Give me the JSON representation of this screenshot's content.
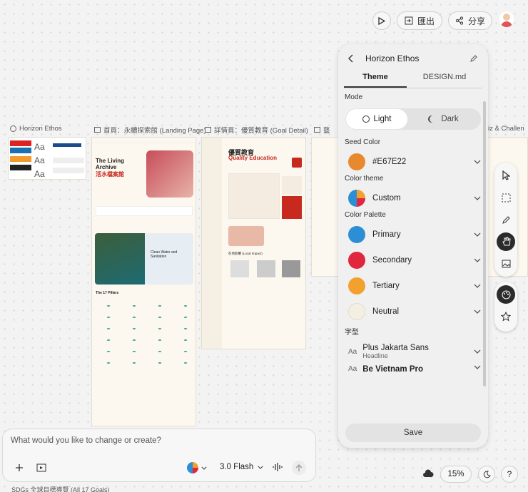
{
  "top": {
    "export": "匯出",
    "share": "分享"
  },
  "frames": {
    "design_system": "Horizon Ethos",
    "landing": "首頁：永續探索館 (Landing Page)",
    "detail": "詳情頁：優質教育 (Goal Detail)",
    "fourth": "藝",
    "fifth": "iz & Challen"
  },
  "landing_page": {
    "title_en": "The Living Archive",
    "title_zh": "活水檔案館",
    "hero_caption": "Clean Water and Sanitation",
    "pillars": "The 17 Pillars"
  },
  "detail_page": {
    "title_zh": "優質教育",
    "title_en": "Quality Education",
    "section": "在地影響 (Local Impact)"
  },
  "panel": {
    "title": "Horizon Ethos",
    "tabs": [
      "Theme",
      "DESIGN.md"
    ],
    "mode_label": "Mode",
    "light": "Light",
    "dark": "Dark",
    "seed_label": "Seed Color",
    "seed_value": "#E67E22",
    "seed_color": "#E8892E",
    "theme_label": "Color theme",
    "theme_value": "Custom",
    "palette_label": "Color Palette",
    "palette": [
      {
        "name": "Primary",
        "color": "#2C8FD6"
      },
      {
        "name": "Secondary",
        "color": "#E0273E"
      },
      {
        "name": "Tertiary",
        "color": "#F2A02E"
      },
      {
        "name": "Neutral",
        "color": "#F3EFE3"
      }
    ],
    "font_label": "字型",
    "fonts": [
      {
        "name": "Plus Jakarta Sans",
        "role": "Headline"
      },
      {
        "name": "Be Vietnam Pro",
        "role": ""
      }
    ],
    "save": "Save"
  },
  "chat": {
    "placeholder": "What would you like to change or create?",
    "model": "3.0 Flash"
  },
  "status": {
    "zoom": "15%",
    "bottom_label": "SDGs 全球目標導覽 (All 17 Goals)"
  }
}
